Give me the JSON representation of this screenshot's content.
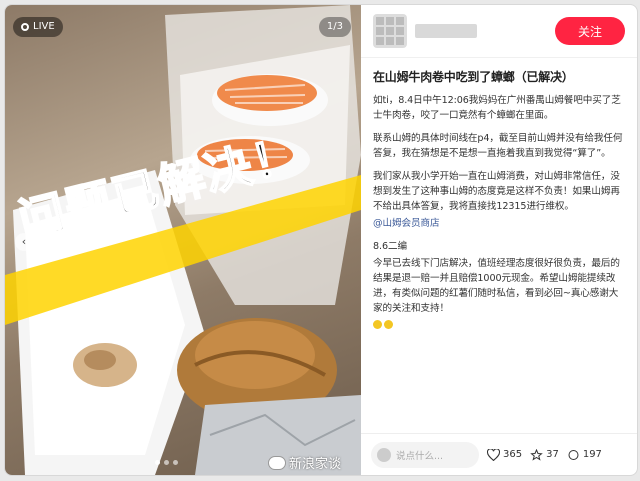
{
  "photo": {
    "live_label": "LIVE",
    "counter": "1/3",
    "overlay_text": "问题已解决！",
    "left_arrow": "‹",
    "right_arrow": "›"
  },
  "author": {
    "follow_label": "关注"
  },
  "post": {
    "title": "在山姆牛肉卷中吃到了蟑螂（已解决）",
    "p1": "如ti，8.4日中午12:06我妈妈在广州番禺山姆餐吧中买了芝士牛肉卷，咬了一口竟然有个蟑螂在里面。",
    "p2": "联系山姆的具体时间线在p4，截至目前山姆并没有给我任何答复，我在猜想是不是想一直拖着我直到我觉得“算了”。",
    "p3": "我们家从我小学开始一直在山姆消费，对山姆非常信任，没想到发生了这种事山姆的态度竟是这样不负责！如果山姆再不给出具体答复，我将直接找12315进行维权。",
    "tag": "@山姆会员商店",
    "update_title": "8.6二编",
    "p4": "今早已去线下门店解决，值班经理态度很好很负责，最后的结果是退一赔一并且赔偿1000元现金。希望山姆能提续改进，有类似问题的红薯们随时私信，看到必回~真心感谢大家的关注和支持！"
  },
  "footer": {
    "comment_placeholder": "说点什么...",
    "likes": "365",
    "stars": "37",
    "comments": "197"
  },
  "watermark": "新浪家谈"
}
